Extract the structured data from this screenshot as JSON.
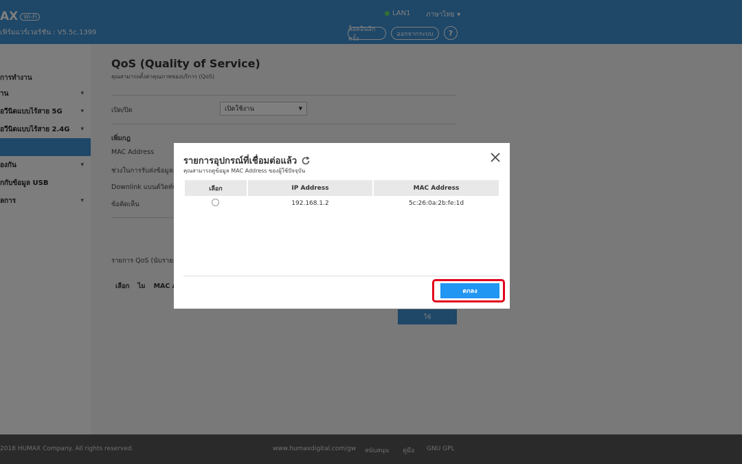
{
  "header": {
    "brand": "AX",
    "brand_tag": "Wi-Fi",
    "subtitle": "เฟิร์มแวร์เวอร์ชัน : V5.5c.1399",
    "lan_status": "LAN1",
    "language": "ภาษาไทย",
    "logout_label": "ล็อคอินอีกครั้ง",
    "logout_btn": "ล็อคอินอีกครั้ง",
    "exit_btn": "ออกจากระบบ",
    "help_label": "?"
  },
  "sidebar": {
    "title": "การทำงาน",
    "items": [
      {
        "label": "าน"
      },
      {
        "label": "อวีนิดแบบไร้สาย 5G"
      },
      {
        "label": "อวีนิดแบบไร้สาย 2.4G"
      },
      {
        "label": ""
      },
      {
        "label": "องกัน"
      },
      {
        "label": "กกับข้อมูล USB"
      },
      {
        "label": "ลการ"
      }
    ]
  },
  "main": {
    "title": "QoS (Quality of Service)",
    "subtitle": "คุณสามารถตั้งค่าคุณภาพของบริการ (QoS)",
    "enable_label": "เปิด/ปิด",
    "enable_value": "เปิดใช้งาน",
    "add_rule_label": "เพิ่มกฎ",
    "mac_label": "MAC Address",
    "upload_label": "ช่วงในการรับส่งข้อมูลอัปโหลด",
    "download_label": "Downlink แบนด์วิดท์(Kb",
    "desc_label": "ข้อคิดเห็น",
    "list_label": "รายการ QoS  (นับรายก",
    "table_headers": [
      "เลือก",
      "ไม",
      "MAC A"
    ],
    "apply_btn": "ใช้"
  },
  "footer": {
    "copyright": "2018 HUMAX Company. All rights reserved.",
    "website": "www.humaxdigital.com/gw",
    "link1": "สนับสนุน",
    "link2": "คู่มือ",
    "link3": "GNU GPL"
  },
  "modal": {
    "title": "รายการอุปกรณ์ที่เชื่อมต่อแล้ว",
    "subtitle": "คุณสามารถดูข้อมูล MAC Address ของผู้ใช้ปัจจุบัน",
    "headers": [
      "เลือก",
      "IP Address",
      "MAC Address"
    ],
    "rows": [
      {
        "ip": "192.168.1.2",
        "mac": "5c:26:0a:2b:fe:1d"
      }
    ],
    "ok_btn": "ตกลง"
  },
  "colors": {
    "header_bg": "#3d8fd0",
    "ok_button": "#2196f3",
    "highlight": "#e1001a"
  }
}
